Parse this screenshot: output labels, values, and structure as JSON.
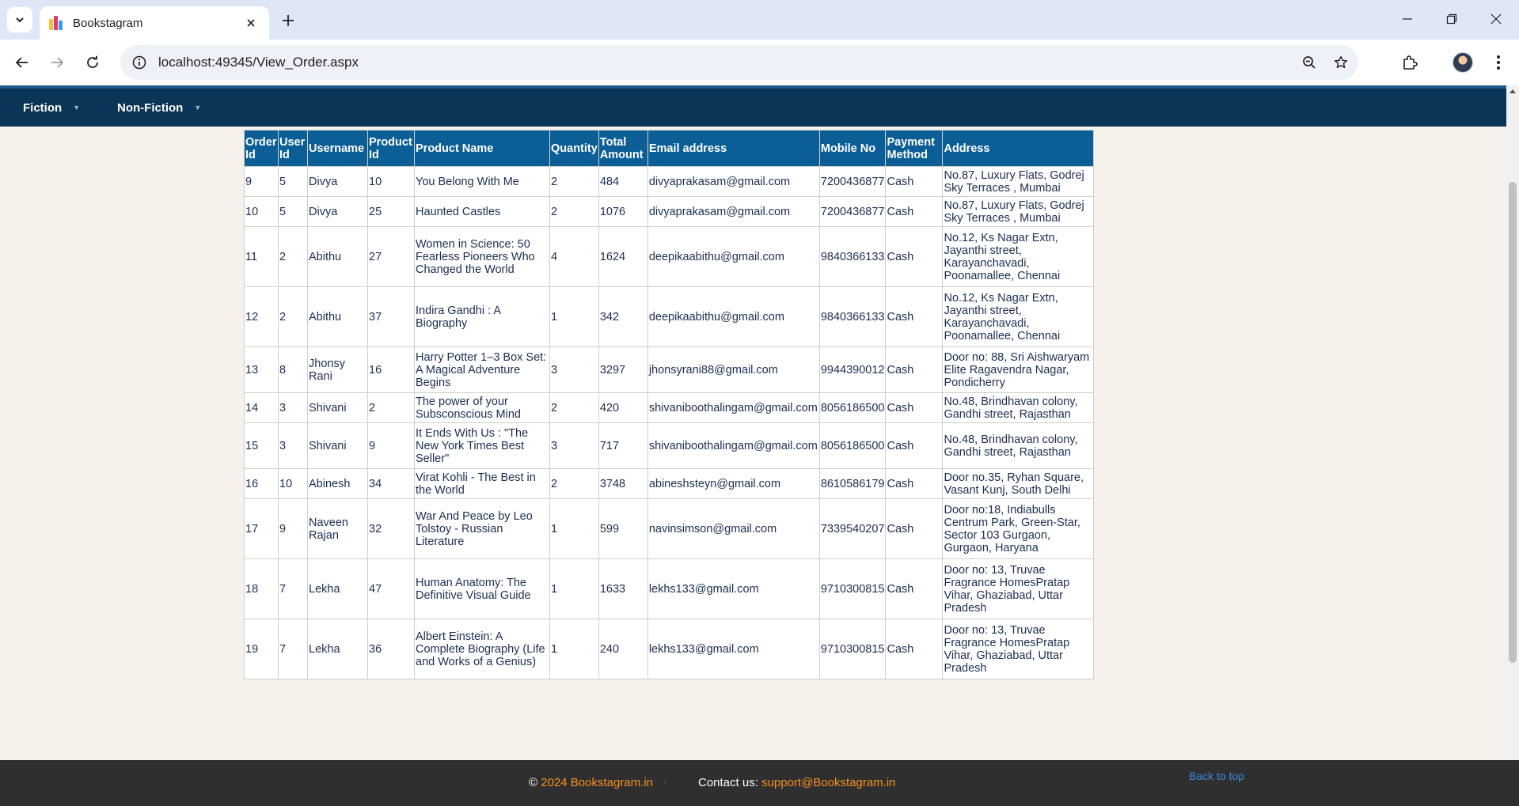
{
  "browser": {
    "tab_title": "Bookstagram",
    "url": "localhost:49345/View_Order.aspx"
  },
  "menu": {
    "items": [
      {
        "label": "Fiction"
      },
      {
        "label": "Non-Fiction"
      }
    ]
  },
  "orders": {
    "headers": [
      "Order Id",
      "User Id",
      "Username",
      "Product Id",
      "Product Name",
      "Quantity",
      "Total Amount",
      "Email address",
      "Mobile No",
      "Payment Method",
      "Address"
    ],
    "rows": [
      [
        "9",
        "5",
        "Divya",
        "10",
        "You Belong With Me",
        "2",
        "484",
        "divyaprakasam@gmail.com",
        "7200436877",
        "Cash",
        "No.87, Luxury Flats, Godrej Sky Terraces , Mumbai"
      ],
      [
        "10",
        "5",
        "Divya",
        "25",
        "Haunted Castles",
        "2",
        "1076",
        "divyaprakasam@gmail.com",
        "7200436877",
        "Cash",
        "No.87, Luxury Flats, Godrej Sky Terraces , Mumbai"
      ],
      [
        "11",
        "2",
        "Abithu",
        "27",
        "Women in Science: 50 Fearless Pioneers Who Changed the World",
        "4",
        "1624",
        "deepikaabithu@gmail.com",
        "9840366133",
        "Cash",
        "No.12, Ks Nagar Extn, Jayanthi street, Karayanchavadi, Poonamallee, Chennai"
      ],
      [
        "12",
        "2",
        "Abithu",
        "37",
        "Indira Gandhi : A Biography",
        "1",
        "342",
        "deepikaabithu@gmail.com",
        "9840366133",
        "Cash",
        "No.12, Ks Nagar Extn, Jayanthi street, Karayanchavadi, Poonamallee, Chennai"
      ],
      [
        "13",
        "8",
        "Jhonsy Rani",
        "16",
        "Harry Potter 1–3 Box Set: A Magical Adventure Begins",
        "3",
        "3297",
        "jhonsyrani88@gmail.com",
        "9944390012",
        "Cash",
        "Door no: 88, Sri Aishwaryam Elite Ragavendra Nagar, Pondicherry"
      ],
      [
        "14",
        "3",
        "Shivani",
        "2",
        "The power of your Subsconscious Mind",
        "2",
        "420",
        "shivaniboothalingam@gmail.com",
        "8056186500",
        "Cash",
        "No.48, Brindhavan colony, Gandhi street, Rajasthan"
      ],
      [
        "15",
        "3",
        "Shivani",
        "9",
        "It Ends With Us : \"The New York Times Best Seller\"",
        "3",
        "717",
        "shivaniboothalingam@gmail.com",
        "8056186500",
        "Cash",
        "No.48, Brindhavan colony, Gandhi street, Rajasthan"
      ],
      [
        "16",
        "10",
        "Abinesh",
        "34",
        "Virat Kohli - The Best in the World",
        "2",
        "3748",
        "abineshsteyn@gmail.com",
        "8610586179",
        "Cash",
        "Door no.35, Ryhan Square, Vasant Kunj, South Delhi"
      ],
      [
        "17",
        "9",
        "Naveen Rajan",
        "32",
        "War And Peace by Leo Tolstoy - Russian Literature",
        "1",
        "599",
        "navinsimson@gmail.com",
        "7339540207",
        "Cash",
        "Door no:18, Indiabulls Centrum Park, Green-Star, Sector 103 Gurgaon, Gurgaon, Haryana"
      ],
      [
        "18",
        "7",
        "Lekha",
        "47",
        "Human Anatomy: The Definitive Visual Guide",
        "1",
        "1633",
        "lekhs133@gmail.com",
        "9710300815",
        "Cash",
        "Door no: 13, Truvae Fragrance HomesPratap Vihar, Ghaziabad, Uttar Pradesh"
      ],
      [
        "19",
        "7",
        "Lekha",
        "36",
        "Albert Einstein: A Complete Biography (Life and Works of a Genius)",
        "1",
        "240",
        "lekhs133@gmail.com",
        "9710300815",
        "Cash",
        "Door no: 13, Truvae Fragrance HomesPratap Vihar, Ghaziabad, Uttar Pradesh"
      ]
    ]
  },
  "footer": {
    "copyright_symbol": "©",
    "copyright_text": "2024 Bookstagram.in",
    "separator": "·",
    "contact_label": "Contact us:",
    "contact_email": "support@Bookstagram.in",
    "back_to_top": "Back to top"
  },
  "icons": {
    "tab_search": "chevron-down-icon",
    "favicon": "bookstagram-logo-icon",
    "tab_close": "close-icon",
    "new_tab": "plus-icon",
    "back": "arrow-left-icon",
    "forward": "arrow-right-icon",
    "reload": "reload-icon",
    "site_info": "info-icon",
    "zoom": "zoom-out-icon",
    "bookmark": "star-icon",
    "extensions": "puzzle-icon",
    "menu": "more-vertical-icon"
  },
  "colors": {
    "menubar": "#0b3556",
    "table_header": "#0b5f96",
    "footer": "#2f2f2f",
    "footer_accent": "#f7921e",
    "link": "#3c8be0"
  }
}
